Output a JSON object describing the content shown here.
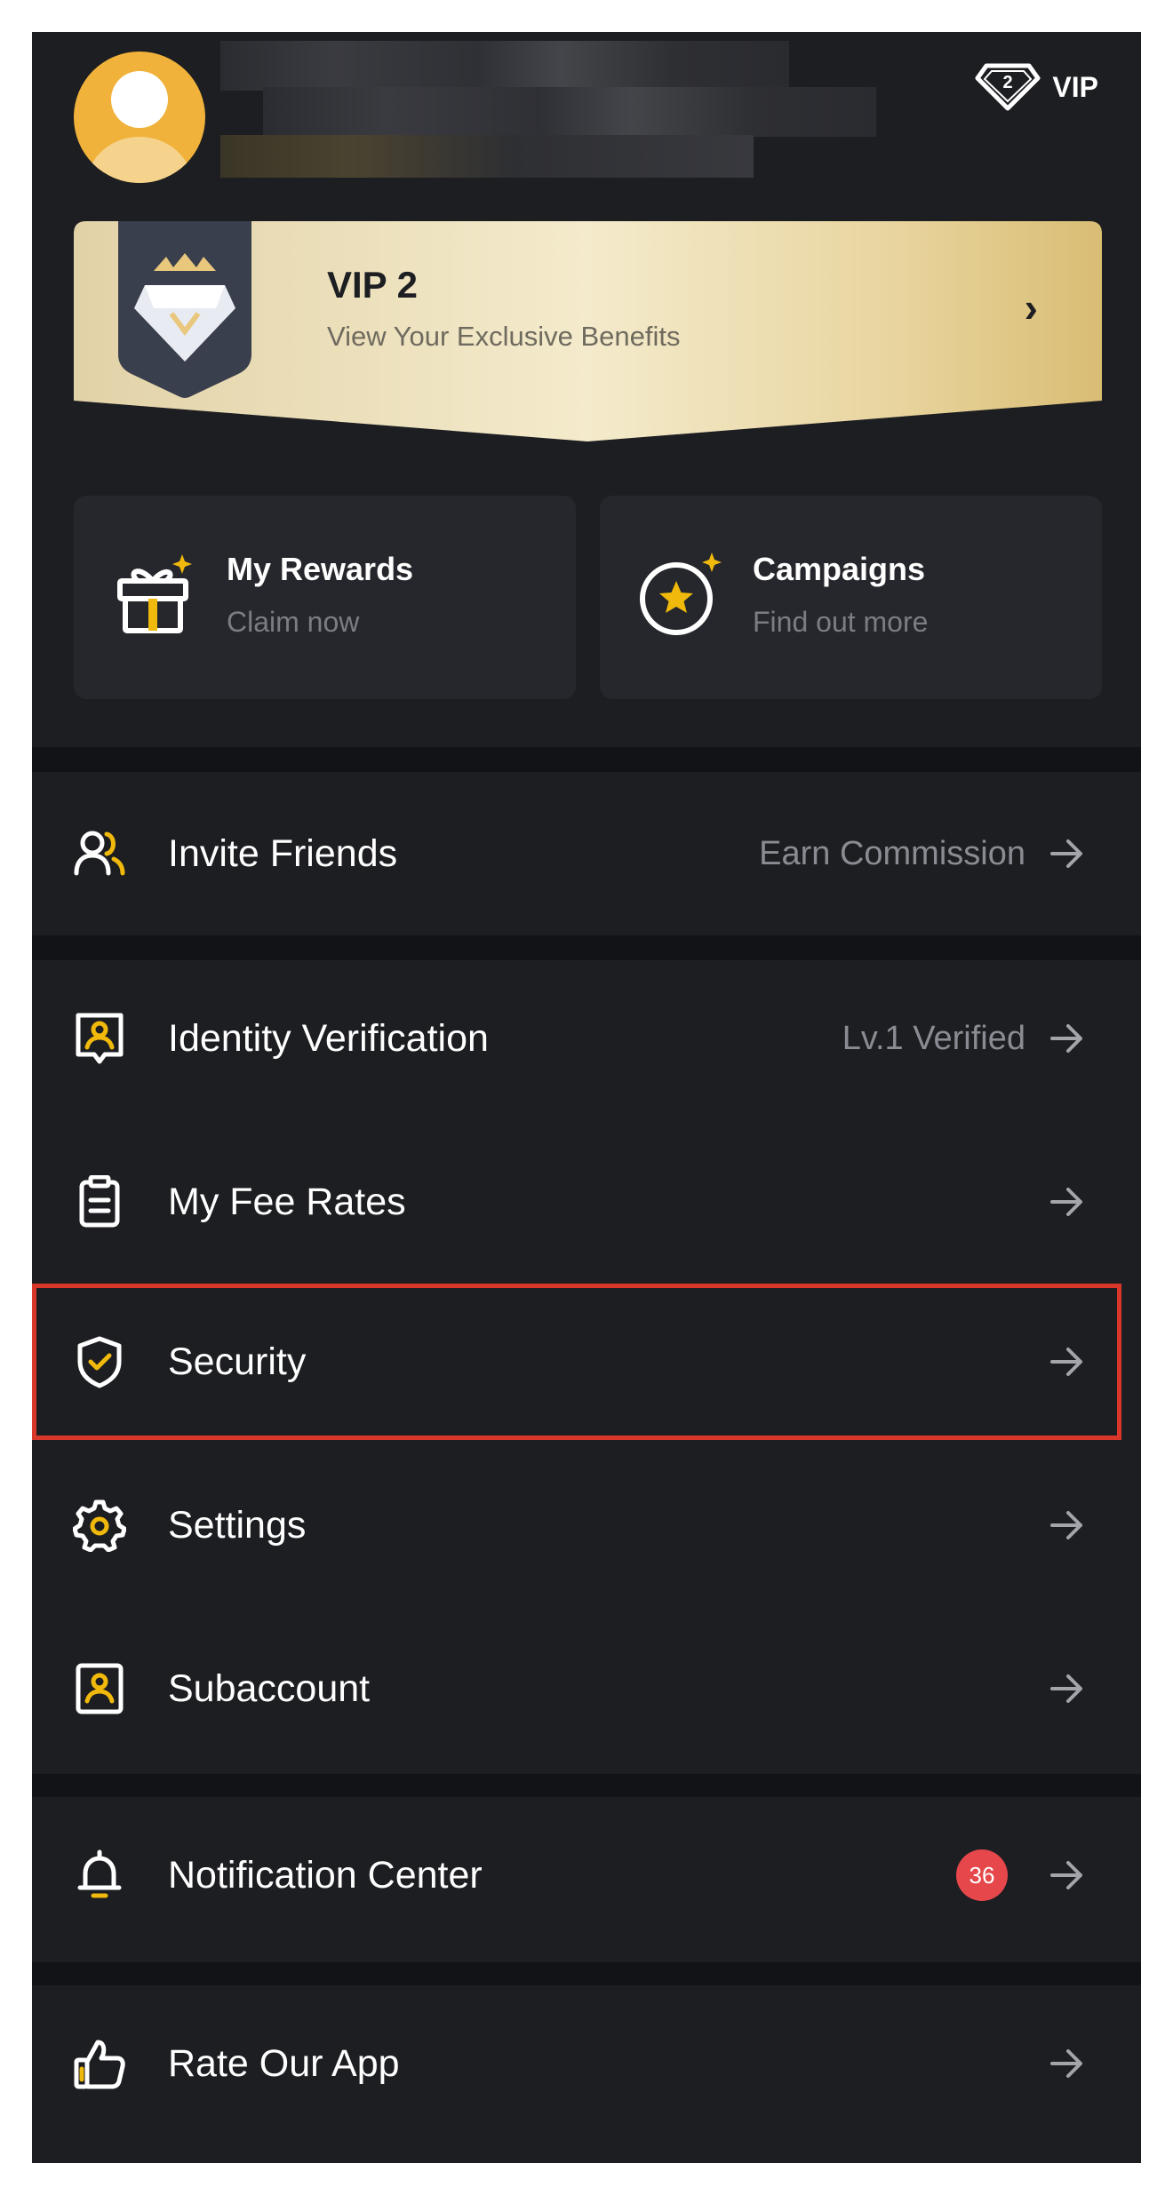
{
  "header": {
    "vip_badge_level": "2",
    "vip_tag_label": "VIP"
  },
  "vip_banner": {
    "title": "VIP 2",
    "subtitle": "View Your Exclusive Benefits",
    "chevron": "›"
  },
  "cards": [
    {
      "title": "My Rewards",
      "subtitle": "Claim now",
      "icon": "gift-icon"
    },
    {
      "title": "Campaigns",
      "subtitle": "Find out more",
      "icon": "campaign-star-icon"
    }
  ],
  "menu": {
    "invite_friends": {
      "label": "Invite Friends",
      "value": "Earn Commission",
      "icon": "invite-friends-icon"
    },
    "identity_verification": {
      "label": "Identity Verification",
      "value": "Lv.1 Verified",
      "icon": "id-card-icon"
    },
    "fee_rates": {
      "label": "My Fee Rates",
      "icon": "clipboard-icon"
    },
    "security": {
      "label": "Security",
      "icon": "shield-check-icon"
    },
    "settings": {
      "label": "Settings",
      "icon": "gear-icon"
    },
    "subaccount": {
      "label": "Subaccount",
      "icon": "subaccount-icon"
    },
    "notification_center": {
      "label": "Notification Center",
      "badge": "36",
      "icon": "bell-icon"
    },
    "rate_app": {
      "label": "Rate Our App",
      "icon": "thumbs-up-icon"
    }
  },
  "colors": {
    "background": "#1d1e22",
    "accent": "#f0b90b",
    "highlight_border": "#d9372a",
    "badge": "#e5474b"
  }
}
